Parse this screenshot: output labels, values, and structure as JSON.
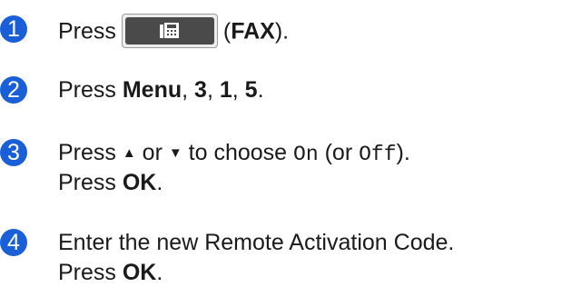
{
  "steps": [
    {
      "number": "1",
      "press": "Press",
      "fax_open": "(",
      "fax_label": "FAX",
      "fax_close": ").",
      "icon": "fax-icon"
    },
    {
      "number": "2",
      "press": "Press",
      "menu": "Menu",
      "sep1": ",",
      "k1": "3",
      "sep2": ",",
      "k2": "1",
      "sep3": ",",
      "k3": "5",
      "end": "."
    },
    {
      "number": "3",
      "press": "Press",
      "up_arrow": "▲",
      "or": "or",
      "down_arrow": "▼",
      "to_choose": "to choose",
      "on_value": "On",
      "or_open": "(or",
      "off_value": "Off",
      "close": ").",
      "line2_press": "Press",
      "ok": "OK",
      "line2_end": "."
    },
    {
      "number": "4",
      "text": "Enter the new Remote Activation Code.",
      "line2_press": "Press",
      "ok": "OK",
      "line2_end": "."
    }
  ],
  "colors": {
    "badge": "#1a5fd8",
    "fax_button": "#4a4a4a"
  }
}
